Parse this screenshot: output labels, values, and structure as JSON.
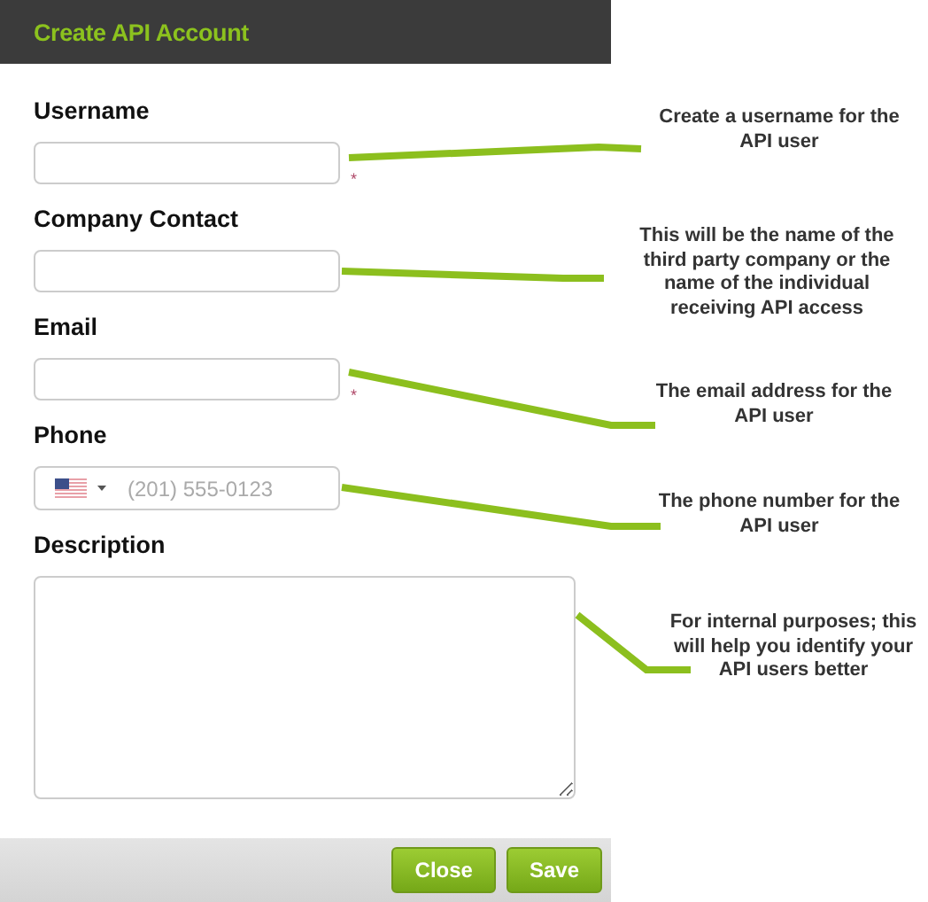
{
  "dialog": {
    "title": "Create API Account",
    "fields": [
      {
        "kind": "text",
        "label": "Username",
        "required_mark": "*",
        "note": "Create a username for the API user"
      },
      {
        "kind": "text",
        "label": "Company Contact",
        "note": "This will be the name of the third party company or the name of the individual receiving API access"
      },
      {
        "kind": "text",
        "label": "Email",
        "required_mark": "*",
        "note": "The email address for the API user"
      },
      {
        "kind": "phone",
        "label": "Phone",
        "placeholder": "(201) 555-0123",
        "note": "The phone number for the API user"
      },
      {
        "kind": "textarea",
        "label": "Description",
        "note": "For internal purposes; this will help you identify your API users better"
      }
    ],
    "buttons": [
      {
        "label": "Close"
      },
      {
        "label": "Save"
      }
    ]
  }
}
